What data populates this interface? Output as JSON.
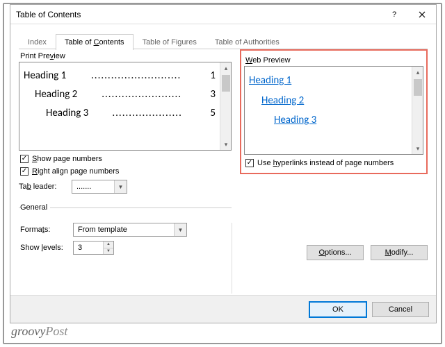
{
  "window": {
    "title": "Table of Contents"
  },
  "tabs": {
    "index": "Index",
    "toc": "Table of Contents",
    "tof": "Table of Figures",
    "toa": "Table of Authorities"
  },
  "print_preview": {
    "label": "Print Preview",
    "rows": [
      {
        "heading": "Heading 1",
        "page": "1"
      },
      {
        "heading": "Heading 2",
        "page": "3"
      },
      {
        "heading": "Heading 3",
        "page": "5"
      }
    ],
    "show_page_numbers": {
      "label": "Show page numbers",
      "checked": true
    },
    "right_align": {
      "label": "Right align page numbers",
      "checked": true
    },
    "tab_leader": {
      "label": "Tab leader:",
      "value": "......."
    }
  },
  "web_preview": {
    "label": "Web Preview",
    "rows": [
      "Heading 1",
      "Heading 2",
      "Heading 3"
    ],
    "use_hyperlinks": {
      "label": "Use hyperlinks instead of page numbers",
      "checked": true
    }
  },
  "general": {
    "legend": "General",
    "formats": {
      "label": "Formats:",
      "value": "From template"
    },
    "show_levels": {
      "label": "Show levels:",
      "value": "3"
    }
  },
  "buttons": {
    "options": "Options...",
    "modify": "Modify...",
    "ok": "OK",
    "cancel": "Cancel"
  },
  "watermark": "groovyPost"
}
